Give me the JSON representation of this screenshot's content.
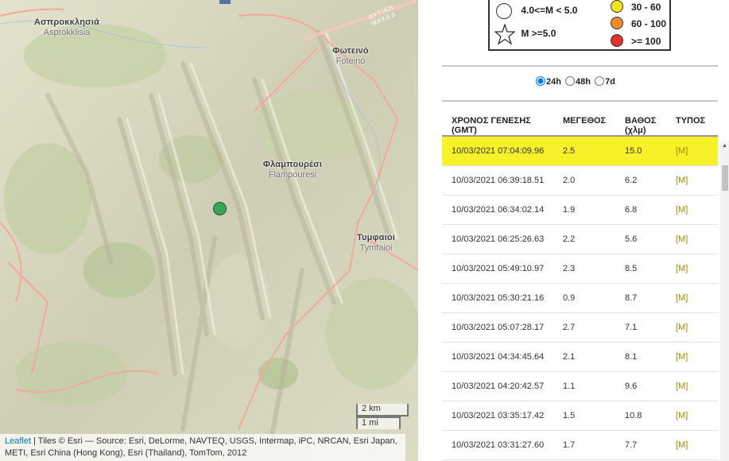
{
  "map": {
    "places": [
      {
        "gr": "Ασπροκκλησιά",
        "lat": "Asprokklisia"
      },
      {
        "gr": "Φωτεινό",
        "lat": "Foteino"
      },
      {
        "gr": "Φλαμπουρέσι",
        "lat": "Flampouresi"
      },
      {
        "gr": "Τυμφαιοι",
        "lat": "Tymfaioi"
      }
    ],
    "road_label": "ΔΥΤΙΚΗ ΜΑΚΕΔ",
    "scale": {
      "metric": "2 km",
      "imperial": "1 mi"
    },
    "attribution": {
      "leaflet": "Leaflet",
      "text": "| Tiles © Esri — Source: Esri, DeLorme, NAVTEQ, USGS, Intermap, iPC, NRCAN, Esri Japan, METI, Esri China (Hong Kong), Esri (Thailand), TomTom, 2012"
    },
    "marker_color": "#3aa35a"
  },
  "legend": {
    "magnitudes": [
      {
        "label": "4.0<=M < 5.0",
        "symbol": "circle-icon"
      },
      {
        "label": "M >=5.0",
        "symbol": "star-icon"
      }
    ],
    "depths": [
      {
        "label": "30 - 60",
        "color": "#f5e61a"
      },
      {
        "label": "60 - 100",
        "color": "#f28a2a"
      },
      {
        "label": ">= 100",
        "color": "#e52e2e"
      }
    ]
  },
  "period": {
    "options": [
      {
        "label": "24h",
        "checked": true
      },
      {
        "label": "48h",
        "checked": false
      },
      {
        "label": "7d",
        "checked": false
      }
    ]
  },
  "table": {
    "headers": [
      "ΧΡΟΝΟΣ ΓΕΝΕΣΗΣ (GMT)",
      "ΜΕΓΕΘΟΣ",
      "ΒΑΘΟΣ (χλμ)",
      "ΤΥΠΟΣ"
    ],
    "rows": [
      [
        "10/03/2021 07:04:09.96",
        "2.5",
        "15.0",
        "[M]"
      ],
      [
        "10/03/2021 06:39:18.51",
        "2.0",
        "6.2",
        "[M]"
      ],
      [
        "10/03/2021 06:34:02.14",
        "1.9",
        "6.8",
        "[M]"
      ],
      [
        "10/03/2021 06:25:26.63",
        "2.2",
        "5.6",
        "[M]"
      ],
      [
        "10/03/2021 05:49:10.97",
        "2.3",
        "8.5",
        "[M]"
      ],
      [
        "10/03/2021 05:30:21.16",
        "0.9",
        "8.7",
        "[M]"
      ],
      [
        "10/03/2021 05:07:28.17",
        "2.7",
        "7.1",
        "[M]"
      ],
      [
        "10/03/2021 04:34:45.64",
        "2.1",
        "8.1",
        "[M]"
      ],
      [
        "10/03/2021 04:20:42.57",
        "1.1",
        "9.6",
        "[M]"
      ],
      [
        "10/03/2021 03:35:17.42",
        "1.5",
        "10.8",
        "[M]"
      ],
      [
        "10/03/2021 03:31:27.60",
        "1.7",
        "7.7",
        "[M]"
      ]
    ],
    "highlight_color": "#f7f12a"
  }
}
